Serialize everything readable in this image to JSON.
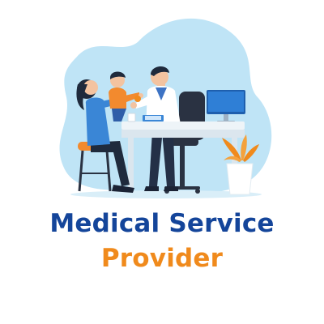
{
  "title": {
    "line1": "Medical Service",
    "line2": "Provider"
  },
  "colors": {
    "title_primary": "#14459a",
    "title_accent": "#f08a1c",
    "background_blob": "#bfe4f6",
    "desk": "#eef4f8",
    "monitor": "#2f7fd6",
    "chair": "#2a3242",
    "plant_leaves": "#f08a1c",
    "vase": "#ffffff"
  },
  "illustration": {
    "scene": "doctor-consultation",
    "elements": [
      "doctor",
      "mother",
      "child",
      "desk",
      "computer-monitor",
      "office-chair",
      "stool",
      "potted-plant",
      "clipboard",
      "coffee-mug"
    ]
  }
}
